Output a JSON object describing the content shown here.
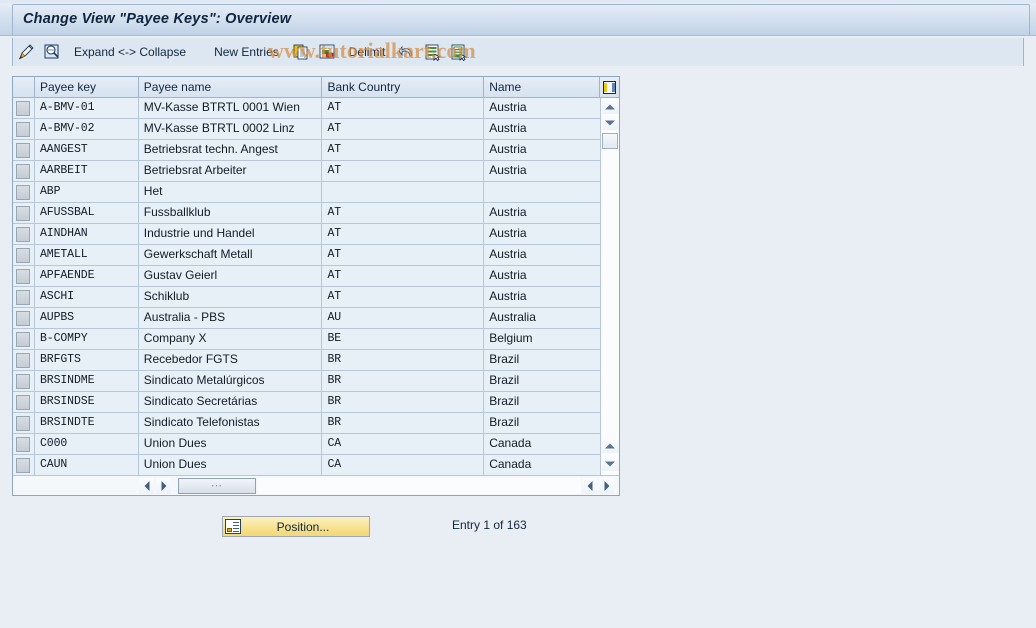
{
  "window": {
    "title": "Change View \"Payee Keys\": Overview"
  },
  "watermark": {
    "text": "www.tutorialkart.com"
  },
  "toolbar": {
    "items": [
      {
        "name": "change-display-icon",
        "label": "",
        "icon": "pencil-icon"
      },
      {
        "name": "display-details-icon",
        "label": "",
        "icon": "magnifier-icon"
      },
      {
        "name": "expand-collapse-button",
        "label": "Expand <-> Collapse",
        "icon": ""
      },
      {
        "name": "new-entries-button",
        "label": "New Entries",
        "icon": ""
      },
      {
        "name": "copy-as-icon",
        "label": "",
        "icon": "copy-icon"
      },
      {
        "name": "delete-icon",
        "label": "",
        "icon": "delete-row-icon"
      },
      {
        "name": "delimit-button",
        "label": "Delimit",
        "icon": ""
      },
      {
        "name": "previous-icon",
        "label": "",
        "icon": "undo-arrow-icon"
      },
      {
        "name": "select-all-icon",
        "label": "",
        "icon": "list-select-icon"
      },
      {
        "name": "select-block-icon",
        "label": "",
        "icon": "list-block-icon"
      }
    ]
  },
  "table": {
    "config_icon": "table-settings-icon",
    "columns": [
      "Payee key",
      "Payee name",
      "Bank Country",
      "Name"
    ],
    "rows": [
      {
        "key": "A-BMV-01",
        "payee_name": "MV-Kasse  BTRTL 0001 Wien",
        "bank_country": "AT",
        "country_name": "Austria"
      },
      {
        "key": "A-BMV-02",
        "payee_name": "MV-Kasse  BTRTL 0002 Linz",
        "bank_country": "AT",
        "country_name": "Austria"
      },
      {
        "key": "AANGEST",
        "payee_name": "Betriebsrat techn. Angest",
        "bank_country": "AT",
        "country_name": "Austria"
      },
      {
        "key": "AARBEIT",
        "payee_name": "Betriebsrat Arbeiter",
        "bank_country": "AT",
        "country_name": "Austria"
      },
      {
        "key": "ABP",
        "payee_name": "Het",
        "bank_country": "",
        "country_name": ""
      },
      {
        "key": "AFUSSBAL",
        "payee_name": "Fussballklub",
        "bank_country": "AT",
        "country_name": "Austria"
      },
      {
        "key": "AINDHAN",
        "payee_name": "Industrie und Handel",
        "bank_country": "AT",
        "country_name": "Austria"
      },
      {
        "key": "AMETALL",
        "payee_name": "Gewerkschaft Metall",
        "bank_country": "AT",
        "country_name": "Austria"
      },
      {
        "key": "APFAENDE",
        "payee_name": "Gustav Geierl",
        "bank_country": "AT",
        "country_name": "Austria"
      },
      {
        "key": "ASCHI",
        "payee_name": "Schiklub",
        "bank_country": "AT",
        "country_name": "Austria"
      },
      {
        "key": "AUPBS",
        "payee_name": "Australia - PBS",
        "bank_country": "AU",
        "country_name": "Australia"
      },
      {
        "key": "B-COMPY",
        "payee_name": "Company X",
        "bank_country": "BE",
        "country_name": "Belgium"
      },
      {
        "key": "BRFGTS",
        "payee_name": "Recebedor FGTS",
        "bank_country": "BR",
        "country_name": "Brazil"
      },
      {
        "key": "BRSINDME",
        "payee_name": "Sindicato Metalúrgicos",
        "bank_country": "BR",
        "country_name": "Brazil"
      },
      {
        "key": "BRSINDSE",
        "payee_name": "Sindicato Secretárias",
        "bank_country": "BR",
        "country_name": "Brazil"
      },
      {
        "key": "BRSINDTE",
        "payee_name": "Sindicato Telefonistas",
        "bank_country": "BR",
        "country_name": "Brazil"
      },
      {
        "key": "C000",
        "payee_name": "Union Dues",
        "bank_country": "CA",
        "country_name": "Canada"
      },
      {
        "key": "CAUN",
        "payee_name": "Union Dues",
        "bank_country": "CA",
        "country_name": "Canada"
      }
    ]
  },
  "footer": {
    "position_button": "Position...",
    "entry_count": "Entry 1 of 163"
  },
  "colors": {
    "title_bar": "#c3d4e8",
    "toolbar": "#dde7f2",
    "page_background": "#e9eef5",
    "row_background": "#e7eff7",
    "header_background": "#dbe6f1",
    "button_yellow": "#f8e396",
    "watermark": "#d68e42"
  }
}
